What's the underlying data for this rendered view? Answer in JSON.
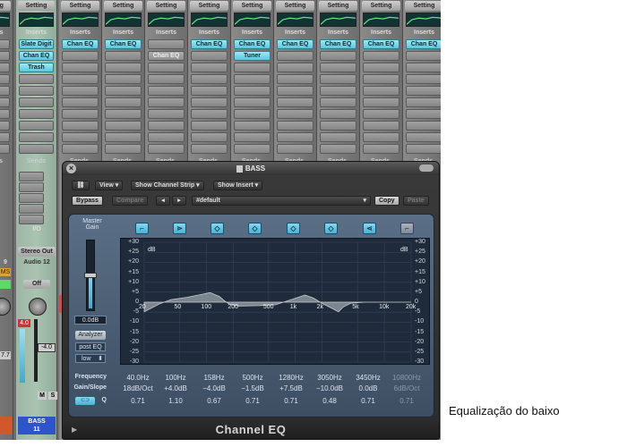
{
  "mixer": {
    "setting_label": "Setting",
    "inserts_label": "Inserts",
    "sends_label": "Sends",
    "strips": [
      {
        "slots": [
          "",
          "",
          ""
        ]
      },
      {
        "slots": [
          "Slate Digit",
          "Chan EQ",
          "Trash"
        ]
      },
      {
        "slots": [
          "Chan EQ",
          "",
          ""
        ]
      },
      {
        "slots": [
          "Chan EQ",
          "",
          ""
        ]
      },
      {
        "slots": [
          "",
          "Chan EQ",
          ""
        ]
      },
      {
        "slots": [
          "Chan EQ",
          "",
          ""
        ]
      },
      {
        "slots": [
          "Chan EQ",
          "Tuner",
          ""
        ]
      },
      {
        "slots": [
          "Chan EQ",
          "",
          ""
        ]
      },
      {
        "slots": [
          "Chan EQ",
          "",
          ""
        ]
      },
      {
        "slots": [
          "Chan EQ",
          "",
          ""
        ]
      },
      {
        "slots": [
          "Chan EQ",
          "",
          ""
        ]
      }
    ],
    "left_strip": {
      "misc1": "9",
      "misc2": "MS",
      "value": "7.7"
    },
    "selected_strip": {
      "io_label": "I/O",
      "output": "Stereo Out",
      "audio": "Audio 12",
      "off": "Off",
      "level": "4.0",
      "fader_value": "-4.0",
      "m": "M",
      "s": "S",
      "name": "BASS",
      "number": "11"
    }
  },
  "plugin": {
    "title": "BASS",
    "view_label": "View",
    "show_channel_strip": "Show Channel Strip",
    "show_insert": "Show Insert",
    "bypass_label": "Bypass",
    "compare_label": "Compare",
    "preset": "#default",
    "copy_label": "Copy",
    "paste_label": "Paste",
    "master_gain_label": "Master\nGain",
    "master_gain_value": "0.0dB",
    "analyzer_label": "Analyzer",
    "post_eq_label": "post EQ",
    "resolution": "low",
    "footer_title": "Channel EQ",
    "db_label": "dB",
    "y_ticks": [
      "+30",
      "+25",
      "+20",
      "+15",
      "+10",
      "+5",
      "0",
      "-5",
      "-10",
      "-15",
      "-20",
      "-25",
      "-30"
    ],
    "x_ticks": [
      "20",
      "50",
      "100",
      "200",
      "500",
      "1k",
      "2k",
      "5k",
      "10k",
      "20k"
    ],
    "row_labels": {
      "frequency": "Frequency",
      "gain_slope": "Gain/Slope",
      "q": "Q"
    },
    "bands": [
      {
        "freq": "40.0Hz",
        "gain": "18dB/Oct",
        "q": "0.71",
        "on": true
      },
      {
        "freq": "100Hz",
        "gain": "+4.0dB",
        "q": "1.10",
        "on": true
      },
      {
        "freq": "158Hz",
        "gain": "−4.0dB",
        "q": "0.67",
        "on": true
      },
      {
        "freq": "500Hz",
        "gain": "−1.5dB",
        "q": "0.71",
        "on": true
      },
      {
        "freq": "1280Hz",
        "gain": "+7.5dB",
        "q": "0.71",
        "on": true
      },
      {
        "freq": "3050Hz",
        "gain": "−10.0dB",
        "q": "0.48",
        "on": true
      },
      {
        "freq": "3450Hz",
        "gain": "0.0dB",
        "q": "0.71",
        "on": true
      },
      {
        "freq": "10800Hz",
        "gain": "6dB/Oct",
        "q": "0.71",
        "on": false
      }
    ],
    "colors": {
      "accent": "#5bc8dc",
      "curve": "#c8c8c8",
      "graph_bg": "#1f2b3a"
    }
  },
  "caption": "Equalização do baixo"
}
